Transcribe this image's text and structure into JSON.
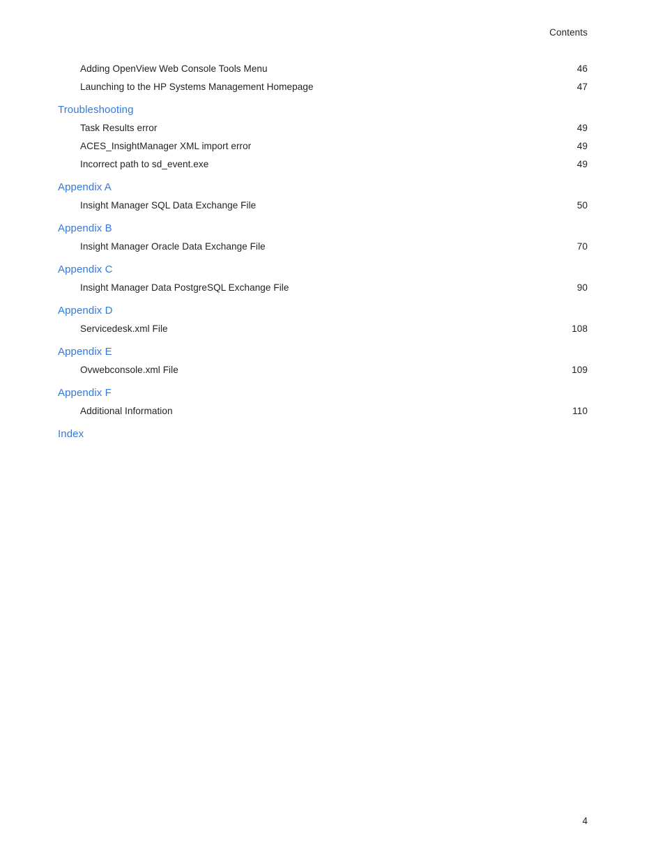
{
  "document": {
    "running_head": "Contents",
    "folio": "4",
    "accent_color": "#3179e0",
    "text_color": "#231f20"
  },
  "toc": {
    "sections": [
      {
        "heading": null,
        "entries": [
          {
            "title": "Adding OpenView Web Console Tools Menu",
            "page": "46",
            "leader_gap": "normal"
          },
          {
            "title": "Launching to the HP Systems Management Homepage",
            "page": "47",
            "leader_gap": "tight"
          }
        ]
      },
      {
        "heading": "Troubleshooting",
        "entries": [
          {
            "title": "Task Results error",
            "page": "49",
            "leader_gap": "normal"
          },
          {
            "title": "ACES_InsightManager XML import error",
            "page": "49",
            "leader_gap": "normal"
          },
          {
            "title": "Incorrect path to sd_event.exe",
            "page": "49",
            "leader_gap": "normal"
          }
        ]
      },
      {
        "heading": "Appendix A",
        "entries": [
          {
            "title": "Insight Manager SQL Data Exchange File",
            "page": "50",
            "leader_gap": "normal"
          }
        ]
      },
      {
        "heading": "Appendix B",
        "entries": [
          {
            "title": "Insight Manager Oracle Data Exchange File",
            "page": "70",
            "leader_gap": "tight"
          }
        ]
      },
      {
        "heading": "Appendix C",
        "entries": [
          {
            "title": "Insight Manager Data PostgreSQL Exchange File",
            "page": "90",
            "leader_gap": "normal"
          }
        ]
      },
      {
        "heading": "Appendix D",
        "entries": [
          {
            "title": "Servicedesk.xml File",
            "page": "108",
            "leader_gap": "normal"
          }
        ]
      },
      {
        "heading": "Appendix E",
        "entries": [
          {
            "title": "Ovwebconsole.xml File",
            "page": "109",
            "leader_gap": "tight"
          }
        ]
      },
      {
        "heading": "Appendix F",
        "entries": [
          {
            "title": "Additional Information",
            "page": "110",
            "leader_gap": "normal"
          }
        ]
      },
      {
        "heading": "Index",
        "entries": []
      }
    ]
  }
}
